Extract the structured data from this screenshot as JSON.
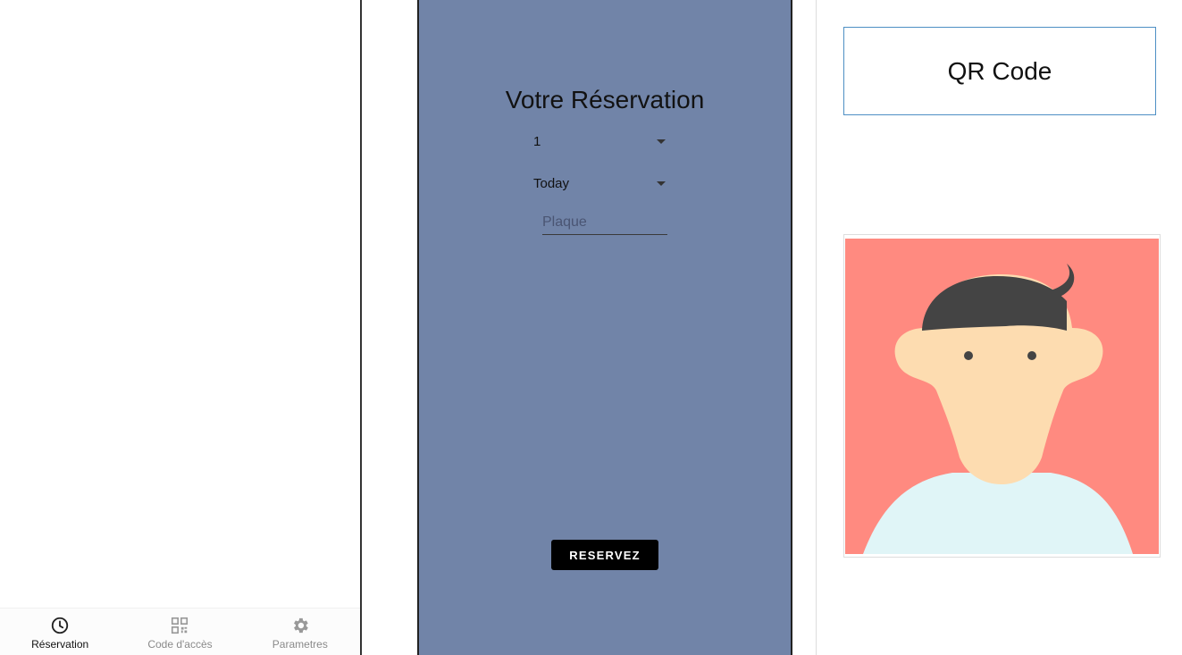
{
  "bottom_nav": {
    "items": [
      {
        "label": "Réservation",
        "icon": "clock-icon",
        "active": true
      },
      {
        "label": "Code d'accès",
        "icon": "qr-code-icon",
        "active": false
      },
      {
        "label": "Parametres",
        "icon": "gear-icon",
        "active": false
      }
    ]
  },
  "reservation": {
    "title": "Votre Réservation",
    "count_select": {
      "value": "1"
    },
    "day_select": {
      "value": "Today"
    },
    "plate_input": {
      "placeholder": "Plaque",
      "value": ""
    },
    "submit_label": "RESERVEZ"
  },
  "qr": {
    "label": "QR Code"
  },
  "avatar": {
    "icon": "user-avatar-illustration"
  },
  "colors": {
    "panel_background": "#7184a8",
    "avatar_background": "#ff8a80",
    "button_background": "#000000",
    "qr_border": "#4e8fc4"
  }
}
